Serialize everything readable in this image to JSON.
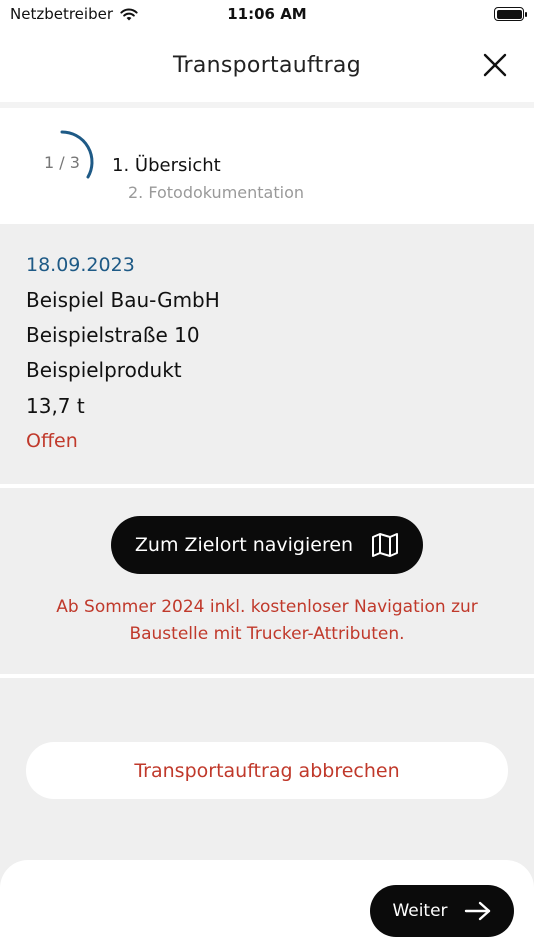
{
  "status_bar": {
    "carrier": "Netzbetreiber",
    "time": "11:06 AM",
    "wifi_icon": "wifi-icon",
    "battery_icon": "battery-icon"
  },
  "header": {
    "title": "Transportauftrag",
    "close_icon": "close-icon"
  },
  "stepper": {
    "count": "1 / 3",
    "progress": 0.3333,
    "current_step": "1. Übersicht",
    "next_step": "2. Fotodokumentation",
    "accent_color": "#1e5a86"
  },
  "order": {
    "date": "18.09.2023",
    "company": "Beispiel Bau-GmbH",
    "address": "Beispielstraße 10",
    "product": "Beispielprodukt",
    "weight": "13,7 t",
    "status": "Offen",
    "status_color": "#c0392b"
  },
  "navigation": {
    "button_label": "Zum Zielort navigieren",
    "button_icon": "map-icon",
    "note": "Ab Sommer 2024 inkl. kostenloser Navigation zur Baustelle mit Trucker-Attributen."
  },
  "actions": {
    "cancel_label": "Transportauftrag abbrechen",
    "next_label": "Weiter",
    "next_icon": "arrow-right-icon"
  }
}
